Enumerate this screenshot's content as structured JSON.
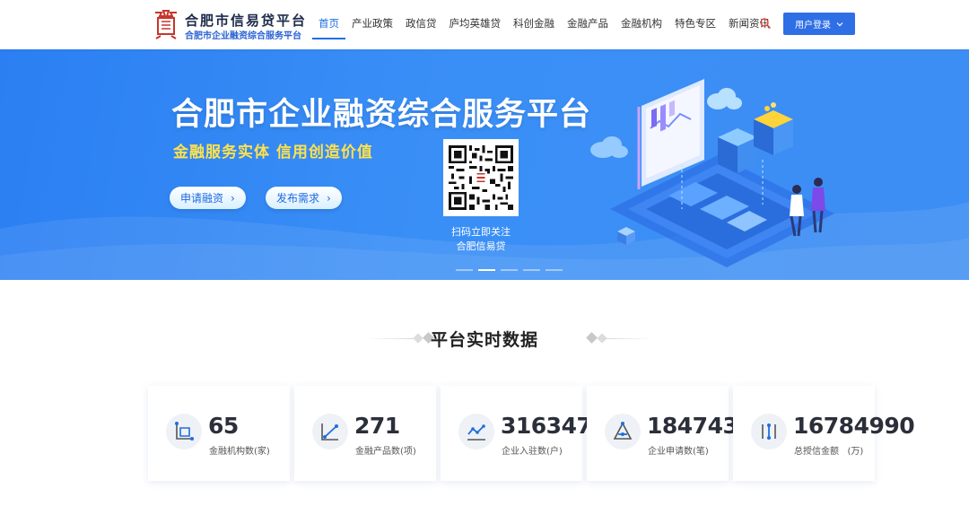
{
  "header": {
    "logo_title": "合肥市信易贷平台",
    "logo_subtitle": "合肥市企业融资综合服务平台",
    "nav": [
      {
        "label": "首页",
        "active": true
      },
      {
        "label": "产业政策",
        "active": false
      },
      {
        "label": "政信贷",
        "active": false
      },
      {
        "label": "庐均英雄贷",
        "active": false
      },
      {
        "label": "科创金融",
        "active": false
      },
      {
        "label": "金融产品",
        "active": false
      },
      {
        "label": "金融机构",
        "active": false
      },
      {
        "label": "特色专区",
        "active": false
      },
      {
        "label": "新闻资讯",
        "active": false
      }
    ],
    "login_label": "用户登录"
  },
  "banner": {
    "title": "合肥市企业融资综合服务平台",
    "slogan": "金融服务实体  信用创造价值",
    "apply_label": "申请融资",
    "publish_label": "发布需求",
    "qr_caption_line1": "扫码立即关注",
    "qr_caption_line2": "合肥信易贷",
    "carousel_active_index": 1,
    "carousel_count": 5
  },
  "section": {
    "title": "平台实时数据"
  },
  "stats": [
    {
      "value": "65",
      "label": "金融机构数(家)",
      "icon": "institution-icon"
    },
    {
      "value": "271",
      "label": "金融产品数(项)",
      "icon": "product-trend-icon"
    },
    {
      "value": "316347",
      "label": "企业入驻数(户)",
      "icon": "enterprise-chart-icon"
    },
    {
      "value": "184743",
      "label": "企业申请数(笔)",
      "icon": "application-triangle-icon"
    },
    {
      "value": "16784990",
      "label": "总授信金额   (万)",
      "icon": "credit-amount-icon"
    }
  ],
  "colors": {
    "primary": "#2f6fe6",
    "nav_active": "#1e6fe0",
    "banner_bg": "#3a8ff6",
    "slogan": "#ffe24a",
    "logo_red": "#c8352b"
  }
}
